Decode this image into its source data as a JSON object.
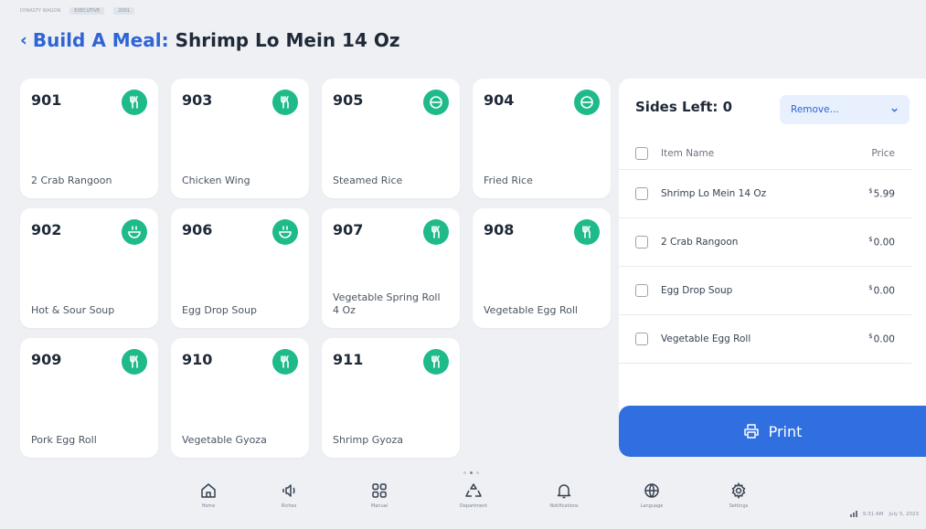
{
  "top_meta": {
    "left_text": "DYNASTY WAGON",
    "pill_1": "EXECUTIVE",
    "pill_2": "2001"
  },
  "header": {
    "prefix": "Build A Meal:",
    "meal_name": "Shrimp Lo Mein 14 Oz"
  },
  "items": [
    {
      "code": "901",
      "name": "2 Crab Rangoon",
      "icon": "utensils-icon"
    },
    {
      "code": "903",
      "name": "Chicken Wing",
      "icon": "utensils-icon"
    },
    {
      "code": "905",
      "name": "Steamed Rice",
      "icon": "rice-bowl-icon"
    },
    {
      "code": "904",
      "name": "Fried Rice",
      "icon": "rice-bowl-icon"
    },
    {
      "code": "902",
      "name": "Hot & Sour Soup",
      "icon": "soup-icon"
    },
    {
      "code": "906",
      "name": "Egg Drop Soup",
      "icon": "soup-icon"
    },
    {
      "code": "907",
      "name": "Vegetable Spring Roll 4 Oz",
      "icon": "utensils-icon"
    },
    {
      "code": "908",
      "name": "Vegetable Egg Roll",
      "icon": "utensils-icon"
    },
    {
      "code": "909",
      "name": "Pork Egg Roll",
      "icon": "utensils-icon"
    },
    {
      "code": "910",
      "name": "Vegetable Gyoza",
      "icon": "utensils-icon"
    },
    {
      "code": "911",
      "name": "Shrimp Gyoza",
      "icon": "utensils-icon"
    }
  ],
  "side_panel": {
    "sides_left_label": "Sides Left: 0",
    "remove_select": "Remove...",
    "col_item": "Item Name",
    "col_price": "Price",
    "rows": [
      {
        "name": "Shrimp Lo Mein 14 Oz",
        "currency": "$",
        "price": "5.99"
      },
      {
        "name": "2 Crab Rangoon",
        "currency": "$",
        "price": "0.00"
      },
      {
        "name": "Egg Drop Soup",
        "currency": "$",
        "price": "0.00"
      },
      {
        "name": "Vegetable Egg Roll",
        "currency": "$",
        "price": "0.00"
      }
    ],
    "print_label": "Print"
  },
  "nav": [
    {
      "label": "Home",
      "icon": "home-icon"
    },
    {
      "label": "Riches",
      "icon": "speaker-icon"
    },
    {
      "label": "Manual",
      "icon": "grid-icon"
    },
    {
      "label": "Department",
      "icon": "recycle-icon"
    },
    {
      "label": "Notifications",
      "icon": "bell-icon"
    },
    {
      "label": "Language",
      "icon": "globe-icon"
    },
    {
      "label": "Settings",
      "icon": "gear-icon"
    }
  ],
  "status_bar": {
    "time": "9:31 AM",
    "date": "July 5, 2023"
  },
  "colors": {
    "accent": "#2f64d6",
    "icon_green": "#1fba8a",
    "print_blue": "#2f6fe0",
    "background": "#eef0f4"
  }
}
